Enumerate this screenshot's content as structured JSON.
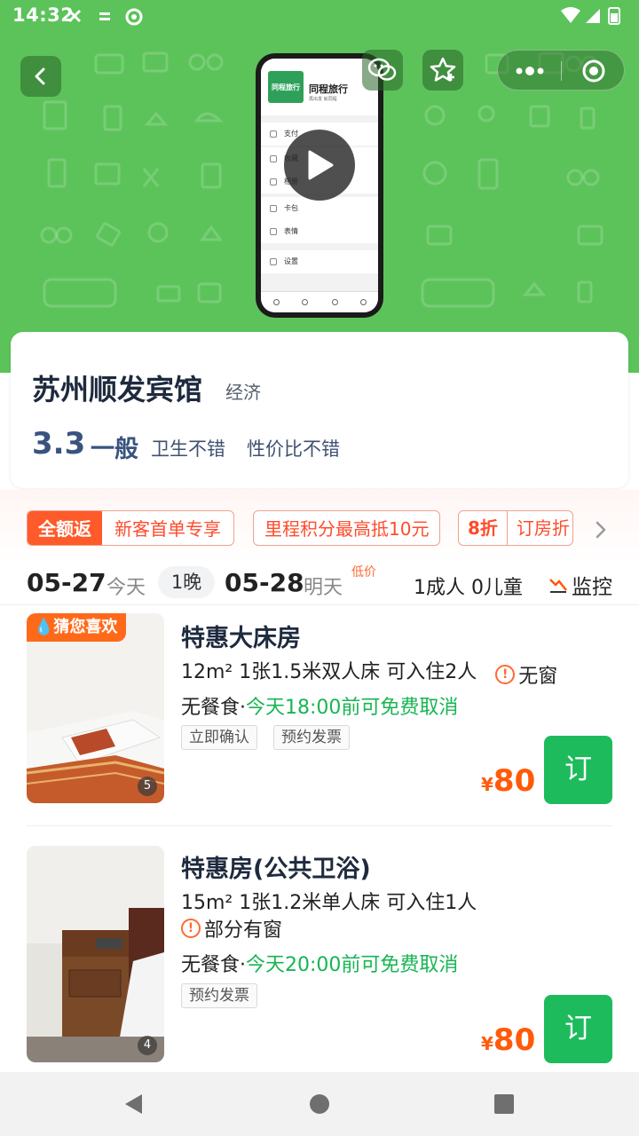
{
  "status_bar": {
    "time": "14:32"
  },
  "hero": {
    "phone_brand": "同程旅行",
    "phone_logo_text": "同程旅行",
    "phone_slogan": "再出发 就同程",
    "phone_menu": [
      "支付",
      "收藏",
      "相册",
      "卡包",
      "表情",
      "设置"
    ]
  },
  "hotel": {
    "name": "苏州顺发宾馆",
    "level": "经济",
    "score": "3.3",
    "score_word": "一般",
    "review_tags": [
      "卫生不错",
      "性价比不错"
    ]
  },
  "promo": {
    "highlight": "全额返",
    "main_text": "新客首单专享",
    "points_text": "里程积分最高抵10元",
    "discount": "8折",
    "discount_text": "订房折"
  },
  "dates": {
    "checkin": "05-27",
    "checkin_day": "今天",
    "nights": "1晚",
    "checkout": "05-28",
    "checkout_day": "明天",
    "low_price": "低价",
    "guests": "1成人 0儿童",
    "monitor": "监控"
  },
  "rooms": [
    {
      "badge": "猜您喜欢",
      "title": "特惠大床房",
      "spec": "12m²  1张1.5米双人床  可入住2人",
      "window": "无窗",
      "meal": "无餐食·",
      "cancel": "今天18:00前可免费取消",
      "tags": [
        "立即确认",
        "预约发票"
      ],
      "currency": "¥",
      "price": "80",
      "book": "订",
      "image_count": "5"
    },
    {
      "title": "特惠房(公共卫浴)",
      "spec": "15m²  1张1.2米单人床  可入住1人",
      "window": "部分有窗",
      "meal": "无餐食·",
      "cancel": "今天20:00前可免费取消",
      "tags": [
        "预约发票"
      ],
      "currency": "¥",
      "price": "80",
      "book": "订",
      "image_count": "4"
    }
  ]
}
